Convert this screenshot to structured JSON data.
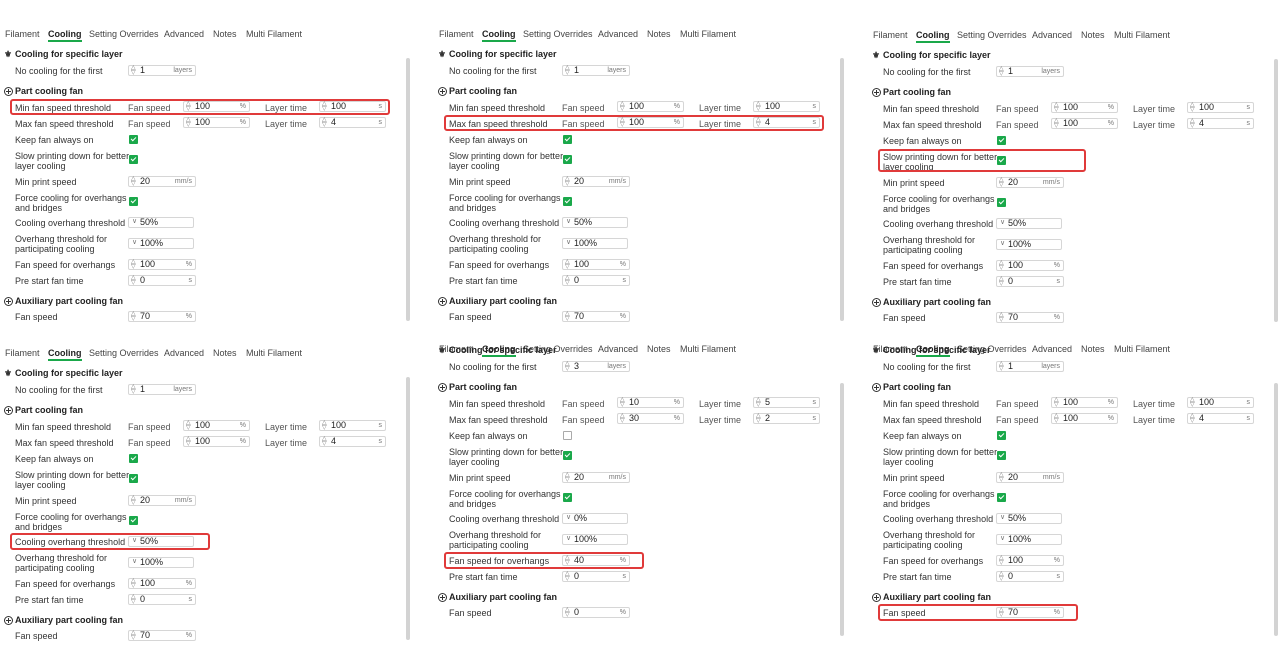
{
  "tabs": [
    "Filament",
    "Cooling",
    "Setting Overrides",
    "Advanced",
    "Notes",
    "Multi Filament"
  ],
  "labels": {
    "cooling_specific": "Cooling for specific layer",
    "no_cooling": "No cooling for the first",
    "part_fan": "Part cooling fan",
    "min_fan": "Min fan speed threshold",
    "max_fan": "Max fan speed threshold",
    "fan_speed": "Fan speed",
    "layer_time": "Layer time",
    "keep_fan": "Keep fan always on",
    "slow_down": "Slow printing down for better layer cooling",
    "min_print": "Min print speed",
    "force_cool": "Force cooling for overhangs and bridges",
    "overhang_threshold": "Cooling overhang threshold",
    "overhang_part": "Overhang threshold for participating cooling",
    "fan_overhang": "Fan speed for overhangs",
    "pre_start": "Pre start fan time",
    "aux_fan": "Auxiliary part cooling fan",
    "aux_fan_speed": "Fan speed"
  },
  "units": {
    "layers": "layers",
    "pct": "%",
    "sec": "s",
    "mms": "mm/s"
  },
  "colors": {
    "accent": "#1aa84a",
    "highlight": "#e03a3a"
  },
  "panels": [
    {
      "no_cooling": "1",
      "min_fan": "100",
      "min_time": "100",
      "max_fan": "100",
      "max_time": "4",
      "keep_fan": true,
      "slow_down": true,
      "min_print": "20",
      "force_cool": true,
      "overhang_threshold": "50%",
      "overhang_part": "100%",
      "fan_overhang": "100",
      "pre_start": "0",
      "aux_fan_speed": "70",
      "highlight": "min_fan"
    },
    {
      "no_cooling": "1",
      "min_fan": "100",
      "min_time": "100",
      "max_fan": "100",
      "max_time": "4",
      "keep_fan": true,
      "slow_down": true,
      "min_print": "20",
      "force_cool": true,
      "overhang_threshold": "50%",
      "overhang_part": "100%",
      "fan_overhang": "100",
      "pre_start": "0",
      "aux_fan_speed": "70",
      "highlight": "max_fan"
    },
    {
      "no_cooling": "1",
      "min_fan": "100",
      "min_time": "100",
      "max_fan": "100",
      "max_time": "4",
      "keep_fan": true,
      "slow_down": true,
      "min_print": "20",
      "force_cool": true,
      "overhang_threshold": "50%",
      "overhang_part": "100%",
      "fan_overhang": "100",
      "pre_start": "0",
      "aux_fan_speed": "70",
      "highlight": "slow_down"
    },
    {
      "no_cooling": "1",
      "min_fan": "100",
      "min_time": "100",
      "max_fan": "100",
      "max_time": "4",
      "keep_fan": true,
      "slow_down": true,
      "min_print": "20",
      "force_cool": true,
      "overhang_threshold": "50%",
      "overhang_part": "100%",
      "fan_overhang": "100",
      "pre_start": "0",
      "aux_fan_speed": "70",
      "highlight": "overhang_threshold"
    },
    {
      "no_cooling": "3",
      "min_fan": "10",
      "min_time": "5",
      "max_fan": "30",
      "max_time": "2",
      "keep_fan": false,
      "slow_down": true,
      "min_print": "20",
      "force_cool": true,
      "overhang_threshold": "0%",
      "overhang_part": "100%",
      "fan_overhang": "40",
      "pre_start": "0",
      "aux_fan_speed": "0",
      "highlight": "fan_overhang"
    },
    {
      "no_cooling": "1",
      "min_fan": "100",
      "min_time": "100",
      "max_fan": "100",
      "max_time": "4",
      "keep_fan": true,
      "slow_down": true,
      "min_print": "20",
      "force_cool": true,
      "overhang_threshold": "50%",
      "overhang_part": "100%",
      "fan_overhang": "100",
      "pre_start": "0",
      "aux_fan_speed": "70",
      "highlight": "aux_fan_speed"
    }
  ]
}
